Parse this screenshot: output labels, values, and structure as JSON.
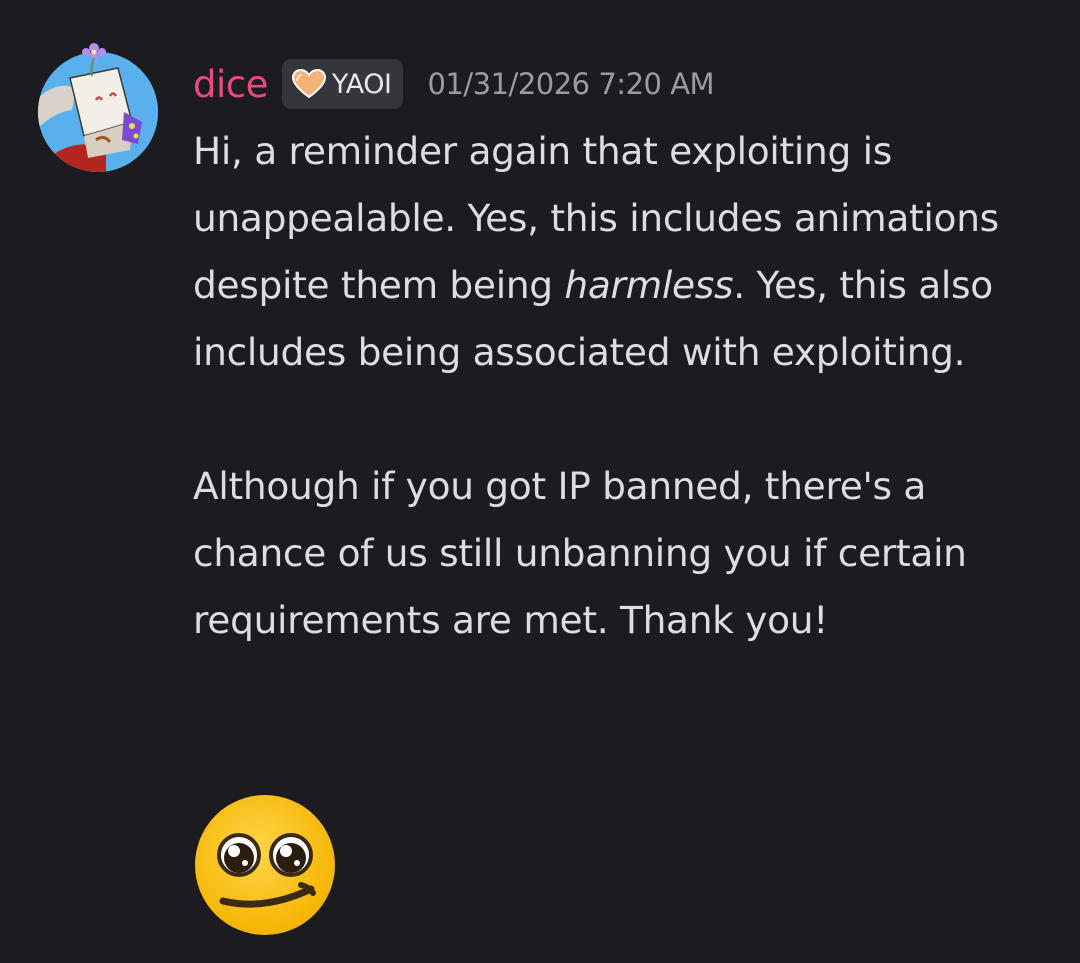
{
  "message": {
    "author": {
      "username": "dice",
      "username_color": "#ea4a7e",
      "role_tag": {
        "icon": "orange-heart-icon",
        "label": "YAOI"
      }
    },
    "timestamp": "01/31/2026 7:20 AM",
    "body": {
      "paragraph_1_start": "Hi, a reminder again that exploiting is unappealable. Yes, this includes animations despite them being ",
      "paragraph_1_emphasis": "harmless",
      "paragraph_1_end": ". Yes, this also includes being associated with exploiting.",
      "paragraph_2": "Although if you got IP banned, there's a chance of us still unbanning you if certain requirements are met. Thank you!"
    },
    "emoji": "pleading-smile-emoji"
  },
  "colors": {
    "background": "#1c1c20",
    "text": "#dcdde2",
    "timestamp": "#9a9ba3",
    "role_tag_background": "#35363c"
  }
}
